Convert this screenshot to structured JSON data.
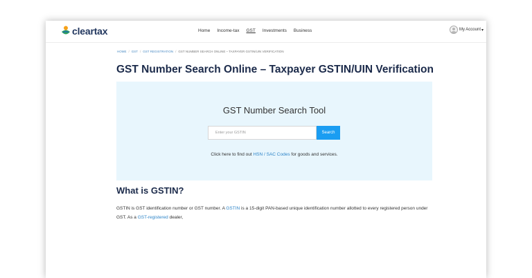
{
  "header": {
    "logo_text": "cleartax",
    "nav": [
      {
        "label": "Home",
        "active": false
      },
      {
        "label": "Income-tax",
        "active": false
      },
      {
        "label": "GST",
        "active": true
      },
      {
        "label": "Investments",
        "active": false
      },
      {
        "label": "Business",
        "active": false
      }
    ],
    "account_label": "My Account",
    "caret": "▾"
  },
  "breadcrumb": {
    "items": [
      "HOME",
      "GST",
      "GST REGISTRATION"
    ],
    "separator": "/",
    "current": "GST NUMBER SEARCH ONLINE – TAXPAYER GSTIN/UIN VERIFICATION"
  },
  "page": {
    "title": "GST Number Search Online – Taxpayer GSTIN/UIN Verification"
  },
  "search": {
    "tool_title": "GST Number Search Tool",
    "placeholder": "Enter your GSTIN",
    "value": "",
    "button_label": "Search",
    "hsn_prefix": "Click here to find out ",
    "hsn_link": "HSN / SAC Codes",
    "hsn_suffix": " for goods and services."
  },
  "section": {
    "title": "What is GSTIN?",
    "p1": "GSTIN is GST identification number or GST number. A ",
    "link1": "GSTIN",
    "p2": " is a 15-digit PAN-based unique identification number allotted to every registered person under GST. As a ",
    "link2": "GST-registered",
    "p3": " dealer,"
  },
  "colors": {
    "brand": "#22375f",
    "accent": "#1a9df2",
    "link": "#2d84c8",
    "panel_bg": "#e8f6fd"
  },
  "icons": {
    "logo": "cleartax-leaf-person-icon",
    "account": "user-avatar-icon"
  }
}
